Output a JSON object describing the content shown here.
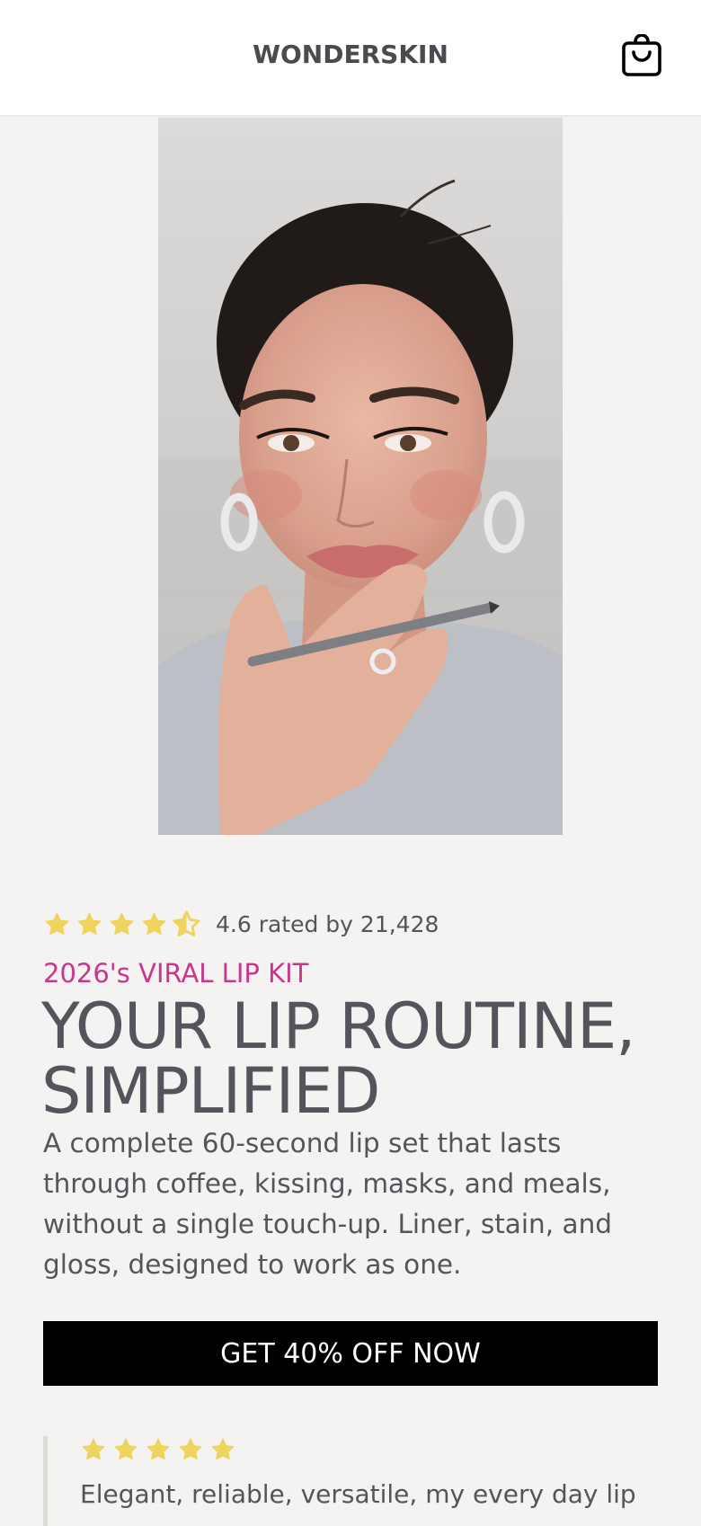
{
  "brand": {
    "name": "WONDERSKIN"
  },
  "header": {
    "cart_icon": "shopping-bag-icon"
  },
  "hero": {
    "image": "woman-applying-lip-liner-photo"
  },
  "rating": {
    "value": 4.6,
    "max": 5,
    "text": "4.6 rated by 21,428",
    "star_color": "#efd35f"
  },
  "product": {
    "kicker": "2026's VIRAL LIP KIT",
    "kicker_color": "#c7388c",
    "headline": "YOUR LIP ROUTINE, SIMPLIFIED",
    "description": "A complete 60-second lip set that lasts through coffee, kissing, masks, and meals, without a single touch-up. Liner, stain, and gloss, designed to work as one."
  },
  "cta": {
    "label": "GET 40% OFF NOW"
  },
  "review": {
    "stars": 5,
    "text": "Elegant, reliable, versatile, my every day lip"
  }
}
